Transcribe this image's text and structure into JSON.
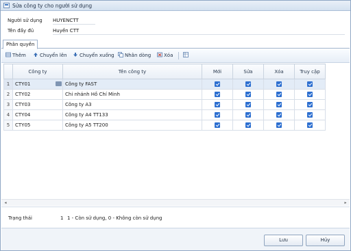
{
  "window": {
    "title": "Sửa công ty cho người sử dụng",
    "icon": "form-icon"
  },
  "form": {
    "user_label": "Người sử dụng",
    "user_value": "HUYENCTT",
    "fullname_label": "Tên đầy đủ",
    "fullname_value": "Huyền CTT"
  },
  "tabs": [
    {
      "label": "Phân quyền"
    }
  ],
  "toolbar": {
    "add": "Thêm",
    "move_up": "Chuyển lên",
    "move_down": "Chuyển xuống",
    "duplicate": "Nhân dòng",
    "delete": "Xóa"
  },
  "grid": {
    "columns": [
      "Công ty",
      "Tên công ty",
      "Mới",
      "Sửa",
      "Xóa",
      "Truy cập"
    ],
    "rows": [
      {
        "num": "1",
        "code": "CTY01",
        "name": "Công ty FAST",
        "new": true,
        "edit": true,
        "del": true,
        "access": true
      },
      {
        "num": "2",
        "code": "CTY02",
        "name": "Chi nhánh Hồ Chí Minh",
        "new": true,
        "edit": true,
        "del": true,
        "access": true
      },
      {
        "num": "3",
        "code": "CTY03",
        "name": "Công ty A3",
        "new": true,
        "edit": true,
        "del": true,
        "access": true
      },
      {
        "num": "4",
        "code": "CTY04",
        "name": "Công ty A4 TT133",
        "new": true,
        "edit": true,
        "del": true,
        "access": true
      },
      {
        "num": "5",
        "code": "CTY05",
        "name": "Công ty A5 TT200",
        "new": true,
        "edit": true,
        "del": true,
        "access": true
      }
    ]
  },
  "status": {
    "label": "Trạng thái",
    "value": "1",
    "description": "1 - Còn sử dụng, 0 - Không còn sử dụng"
  },
  "buttons": {
    "save": "Lưu",
    "cancel": "Hủy"
  },
  "colors": {
    "accent": "#2d6fd0",
    "selected_row": "#e3ecf7",
    "border": "#8ea6c4"
  }
}
